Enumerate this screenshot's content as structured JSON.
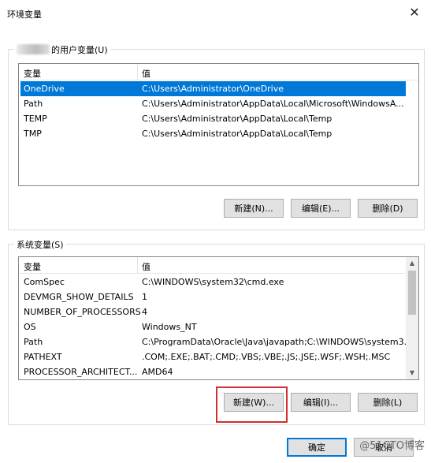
{
  "window": {
    "title": "环境变量",
    "close_glyph": "✕"
  },
  "user_vars": {
    "group_label": "的用户变量(U)",
    "col_name": "变量",
    "col_value": "值",
    "rows": [
      {
        "name": "OneDrive",
        "value": "C:\\Users\\Administrator\\OneDrive",
        "selected": true
      },
      {
        "name": "Path",
        "value": "C:\\Users\\Administrator\\AppData\\Local\\Microsoft\\WindowsA...",
        "selected": false
      },
      {
        "name": "TEMP",
        "value": "C:\\Users\\Administrator\\AppData\\Local\\Temp",
        "selected": false
      },
      {
        "name": "TMP",
        "value": "C:\\Users\\Administrator\\AppData\\Local\\Temp",
        "selected": false
      }
    ],
    "buttons": {
      "new": "新建(N)...",
      "edit": "编辑(E)...",
      "delete": "删除(D)"
    }
  },
  "system_vars": {
    "group_label": "系统变量(S)",
    "col_name": "变量",
    "col_value": "值",
    "rows": [
      {
        "name": "ComSpec",
        "value": "C:\\WINDOWS\\system32\\cmd.exe"
      },
      {
        "name": "DEVMGR_SHOW_DETAILS",
        "value": "1"
      },
      {
        "name": "NUMBER_OF_PROCESSORS",
        "value": "4"
      },
      {
        "name": "OS",
        "value": "Windows_NT"
      },
      {
        "name": "Path",
        "value": "C:\\ProgramData\\Oracle\\Java\\javapath;C:\\WINDOWS\\system3..."
      },
      {
        "name": "PATHEXT",
        "value": ".COM;.EXE;.BAT;.CMD;.VBS;.VBE;.JS;.JSE;.WSF;.WSH;.MSC"
      },
      {
        "name": "PROCESSOR_ARCHITECT...",
        "value": "AMD64"
      }
    ],
    "buttons": {
      "new": "新建(W)...",
      "edit": "编辑(I)...",
      "delete": "删除(L)"
    }
  },
  "footer": {
    "ok": "确定",
    "cancel": "取消"
  },
  "watermark": "@51CTO博客",
  "colors": {
    "selection": "#0078d7",
    "highlight_box": "#d03030"
  }
}
